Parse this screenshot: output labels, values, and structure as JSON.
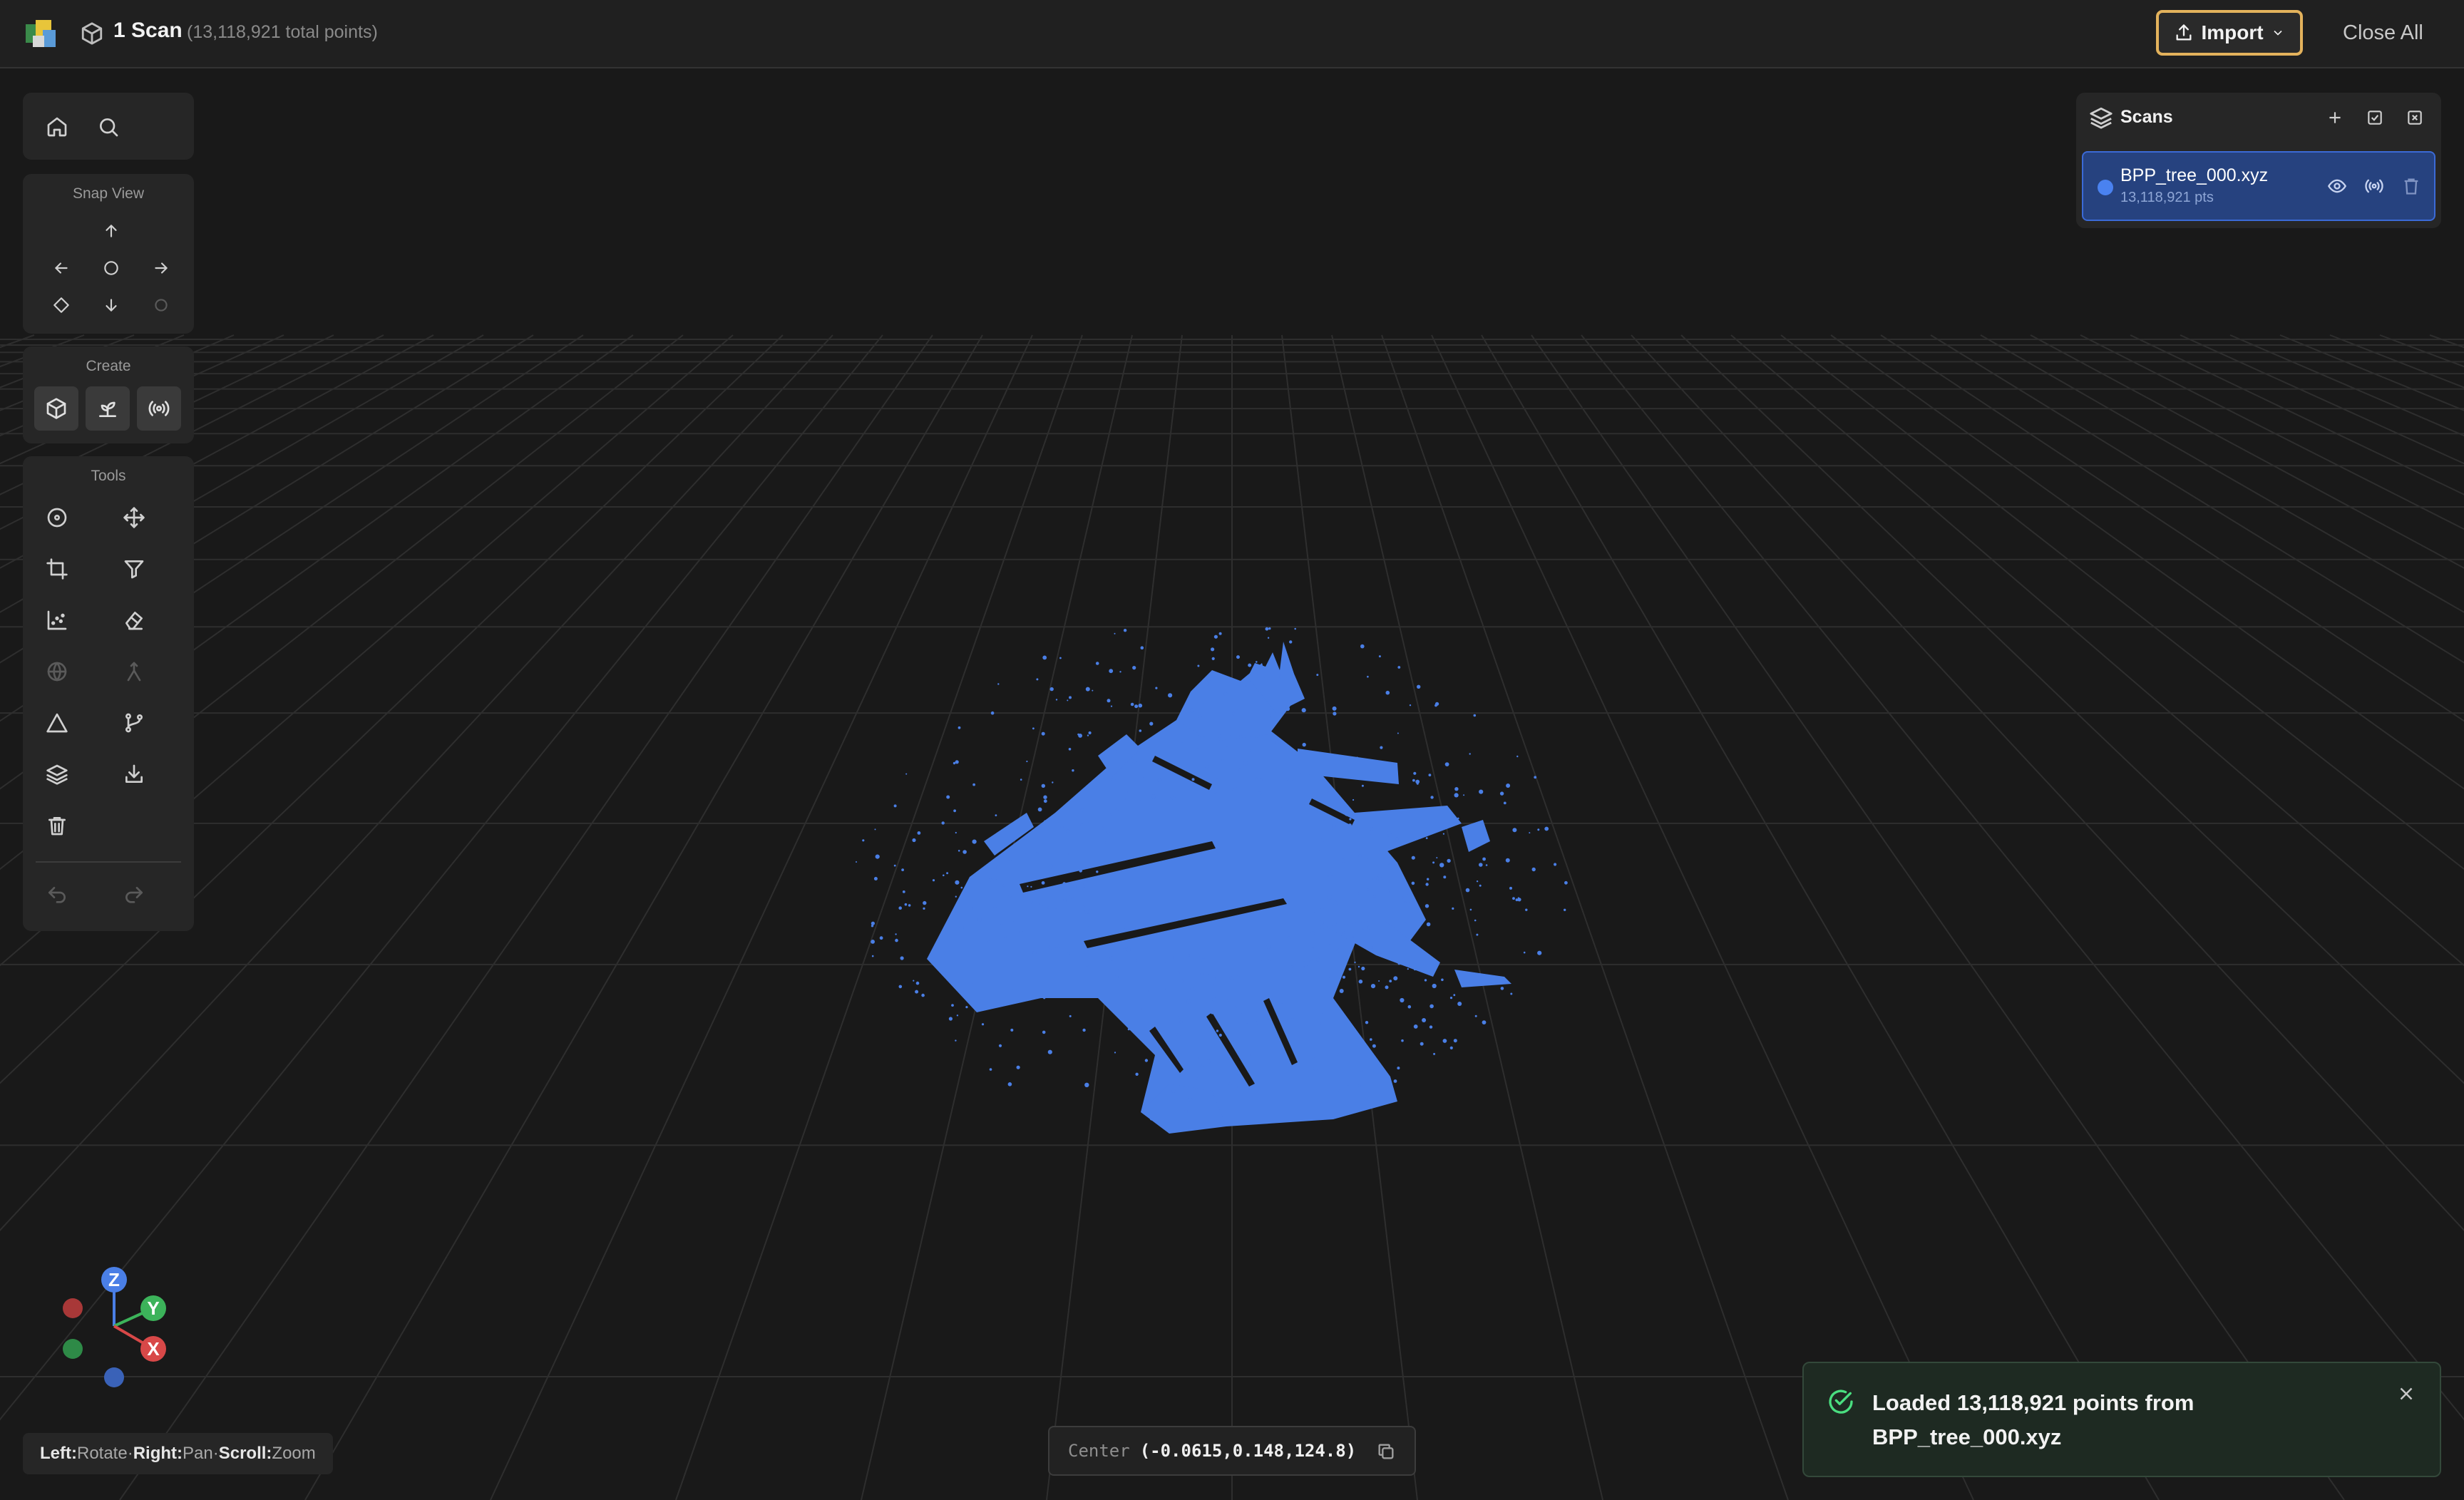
{
  "header": {
    "title": "1 Scan",
    "subtitle": "(13,118,921 total points)",
    "import_label": "Import",
    "close_all_label": "Close All"
  },
  "snap_view": {
    "label": "Snap View"
  },
  "create": {
    "label": "Create"
  },
  "tools": {
    "label": "Tools"
  },
  "scans_panel": {
    "title": "Scans",
    "items": [
      {
        "name": "BPP_tree_000.xyz",
        "points": "13,118,921 pts",
        "color": "#4a82f0"
      }
    ]
  },
  "gizmo": {
    "z": "Z",
    "y": "Y",
    "x": "X"
  },
  "controls_hint": {
    "left_key": "Left:",
    "left_action": "Rotate",
    "right_key": "Right:",
    "right_action": "Pan",
    "scroll_key": "Scroll:",
    "scroll_action": "Zoom",
    "separator": "·"
  },
  "center_readout": {
    "label": "Center",
    "value": "(-0.0615,0.148,124.8)"
  },
  "toast": {
    "message": "Loaded 13,118,921 points from BPP_tree_000.xyz"
  },
  "colors": {
    "accent": "#e3b25c",
    "point_cloud": "#4a7fe6",
    "scan_row": "#26427f",
    "success": "#4ade80"
  }
}
